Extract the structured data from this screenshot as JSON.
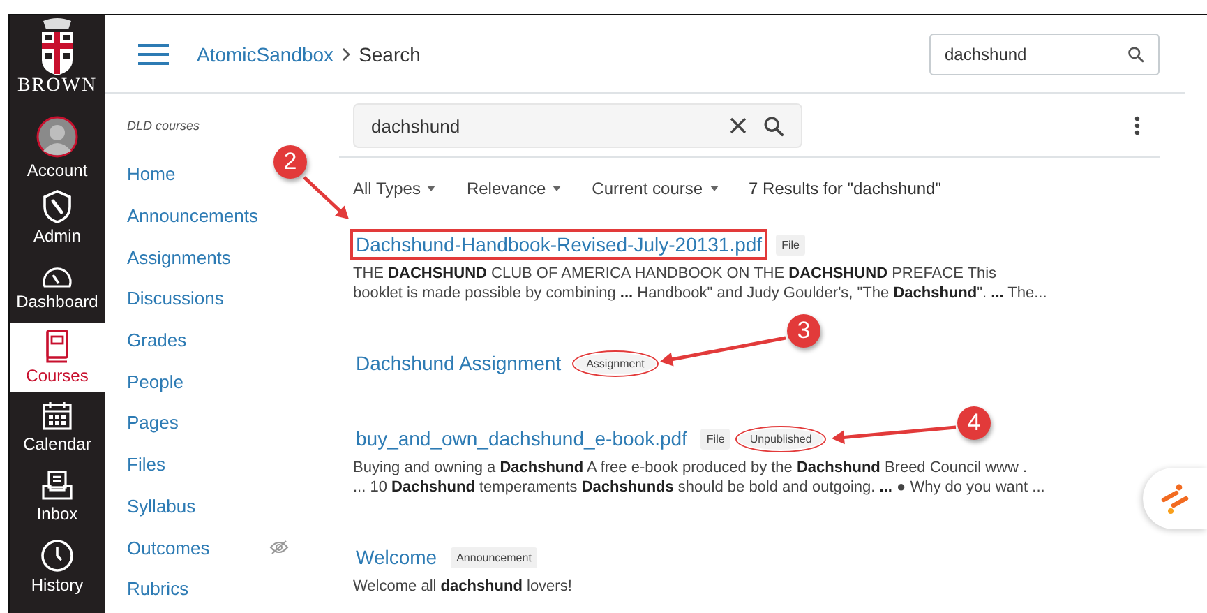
{
  "global_nav": {
    "logo_text": "BROWN",
    "items": [
      {
        "label": "Account",
        "kind": "avatar",
        "selected": false
      },
      {
        "label": "Admin",
        "kind": "shield",
        "selected": false
      },
      {
        "label": "Dashboard",
        "kind": "gauge",
        "selected": false
      },
      {
        "label": "Courses",
        "kind": "book",
        "selected": true
      },
      {
        "label": "Calendar",
        "kind": "calendar",
        "selected": false
      },
      {
        "label": "Inbox",
        "kind": "inbox",
        "selected": false
      },
      {
        "label": "History",
        "kind": "clock",
        "selected": false
      }
    ]
  },
  "header": {
    "breadcrumb": [
      "AtomicSandbox",
      "Search"
    ],
    "search": {
      "value": "dachshund"
    }
  },
  "course_nav": {
    "heading": "DLD courses",
    "items": [
      {
        "label": "Home",
        "hidden": false
      },
      {
        "label": "Announcements",
        "hidden": false
      },
      {
        "label": "Assignments",
        "hidden": false
      },
      {
        "label": "Discussions",
        "hidden": false
      },
      {
        "label": "Grades",
        "hidden": false
      },
      {
        "label": "People",
        "hidden": false
      },
      {
        "label": "Pages",
        "hidden": false
      },
      {
        "label": "Files",
        "hidden": false
      },
      {
        "label": "Syllabus",
        "hidden": false
      },
      {
        "label": "Outcomes",
        "hidden": true
      },
      {
        "label": "Rubrics",
        "hidden": false
      }
    ]
  },
  "search": {
    "value": "dachshund"
  },
  "filters": [
    "All Types",
    "Relevance",
    "Current course"
  ],
  "result_count": "7 Results for \"dachshund\"",
  "results": [
    {
      "title": "Dachshund-Handbook-Revised-July-20131.pdf",
      "boxed": true,
      "badges": [
        {
          "text": "File",
          "circled": false
        }
      ],
      "snippet": [
        "THE **DACHSHUND** CLUB OF AMERICA HANDBOOK ON THE **DACHSHUND** PREFACE This",
        "booklet is made possible by combining **...** Handbook\" and Judy Goulder's, \"The **Dachshund**\". **...** The..."
      ]
    },
    {
      "title": "Dachshund Assignment",
      "boxed": false,
      "badges": [
        {
          "text": "Assignment",
          "circled": true
        }
      ]
    },
    {
      "title": "buy_and_own_dachshund_e-book.pdf",
      "boxed": false,
      "badges": [
        {
          "text": "File",
          "circled": false
        },
        {
          "text": "Unpublished",
          "circled": true
        }
      ],
      "snippet": [
        "Buying and owning a **Dachshund** A free e-book produced by the **Dachshund** Breed Council www .",
        "... 10 **Dachshund** temperaments **Dachshunds** should be bold and outgoing. **...** ● Why do you want ..."
      ]
    },
    {
      "title": "Welcome",
      "boxed": false,
      "badges": [
        {
          "text": "Announcement",
          "circled": false
        }
      ],
      "snippet": [
        "Welcome all **dachshund** lovers!"
      ]
    }
  ],
  "callouts": [
    {
      "number": "2"
    },
    {
      "number": "3"
    },
    {
      "number": "4"
    }
  ]
}
